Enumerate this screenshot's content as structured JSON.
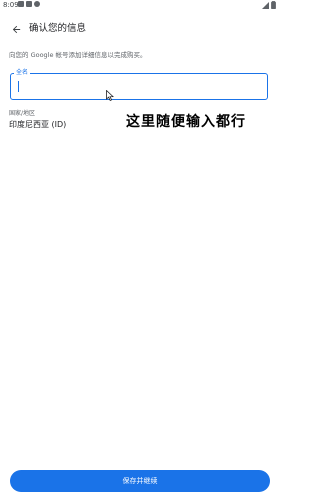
{
  "status_bar": {
    "time": "8:09"
  },
  "header": {
    "back_icon": "arrow-back-icon",
    "title": "确认您的信息"
  },
  "form": {
    "subtitle": "向您的 Google 帐号添加详细信息以完成购买。",
    "name_field": {
      "label": "全名",
      "value": ""
    },
    "country": {
      "label": "国家/地区",
      "value": "印度尼西亚 (ID)"
    }
  },
  "annotation": "这里随便输入都行",
  "footer": {
    "save_label": "保存并继续"
  },
  "colors": {
    "accent": "#1a73e8",
    "text_primary": "#202124",
    "text_secondary": "#5f6368",
    "background": "#ffffff"
  }
}
